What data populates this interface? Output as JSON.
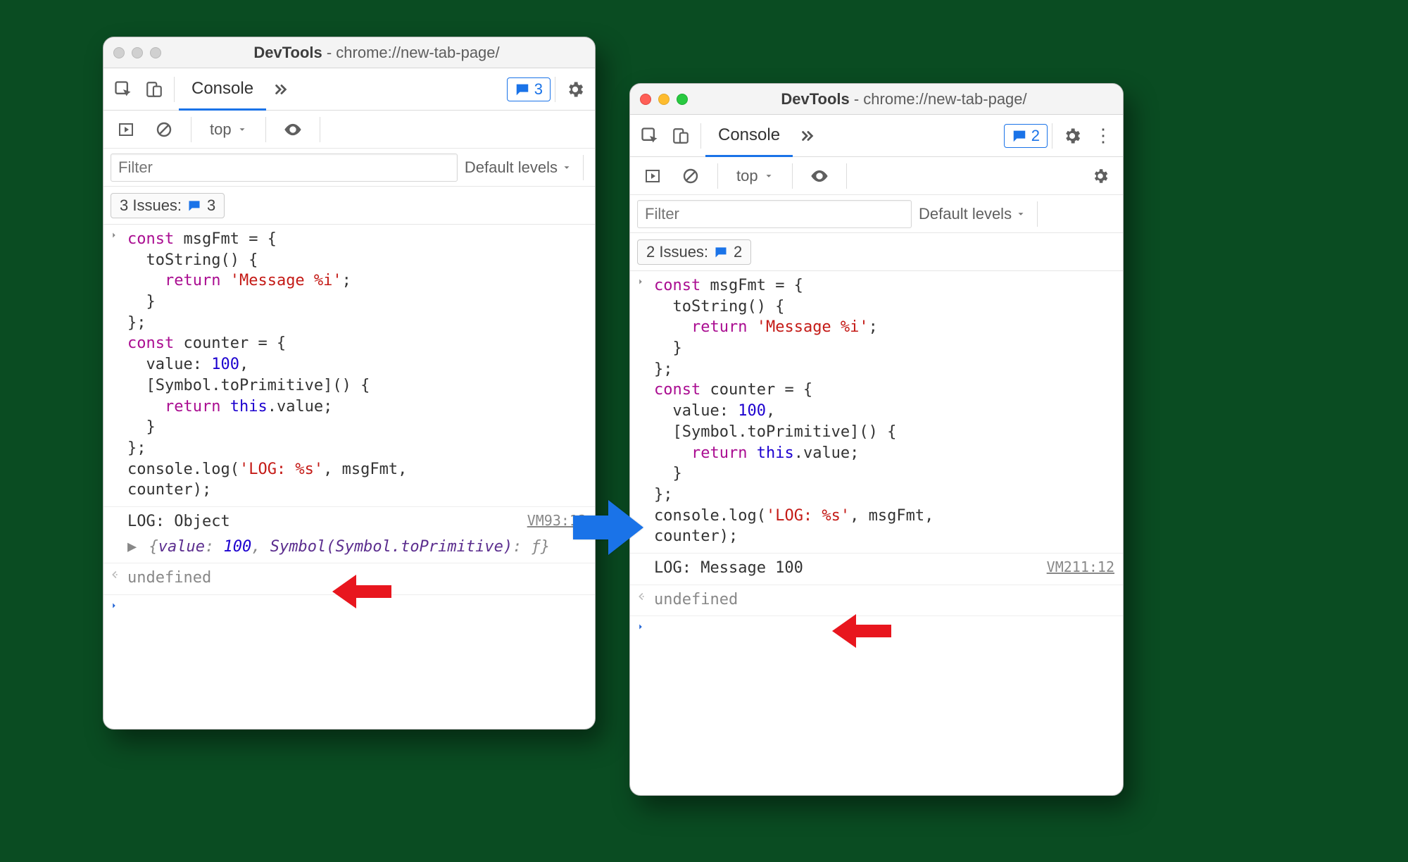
{
  "window_title": {
    "app": "DevTools",
    "sep": " - ",
    "page": "chrome://new-tab-page/"
  },
  "left": {
    "tab": "Console",
    "top": "top",
    "filter_placeholder": "Filter",
    "levels_label": "Default levels",
    "issues_prefix": "3 Issues:",
    "issues_count": "3",
    "badge_count": "3",
    "log_line": "LOG: Object",
    "source_ref": "VM93:12",
    "object_preview_open": "{",
    "object_preview_k1": "value",
    "object_preview_v1": "100",
    "object_preview_k2": "Symbol(Symbol.toPrimitive)",
    "object_preview_v2": "ƒ",
    "object_preview_close": "}",
    "undefined": "undefined"
  },
  "right": {
    "tab": "Console",
    "top": "top",
    "filter_placeholder": "Filter",
    "levels_label": "Default levels",
    "issues_prefix": "2 Issues:",
    "issues_count": "2",
    "badge_count": "2",
    "log_line": "LOG: Message 100",
    "source_ref": "VM211:12",
    "undefined": "undefined"
  },
  "code": {
    "l1a": "const",
    "l1b": " msgFmt = {",
    "l2": "  toString() {",
    "l3a": "    ",
    "l3b": "return",
    "l3c": " ",
    "l3d": "'Message %i'",
    "l3e": ";",
    "l4": "  }",
    "l5": "};",
    "l6a": "const",
    "l6b": " counter = {",
    "l7a": "  value: ",
    "l7b": "100",
    "l7c": ",",
    "l8": "  [Symbol.toPrimitive]() {",
    "l9a": "    ",
    "l9b": "return",
    "l9c": " ",
    "l9d": "this",
    "l9e": ".value;",
    "l10": "  }",
    "l11": "};",
    "l12a": "console.log(",
    "l12b": "'LOG: %s'",
    "l12c": ", msgFmt,",
    "l13": "counter);"
  }
}
